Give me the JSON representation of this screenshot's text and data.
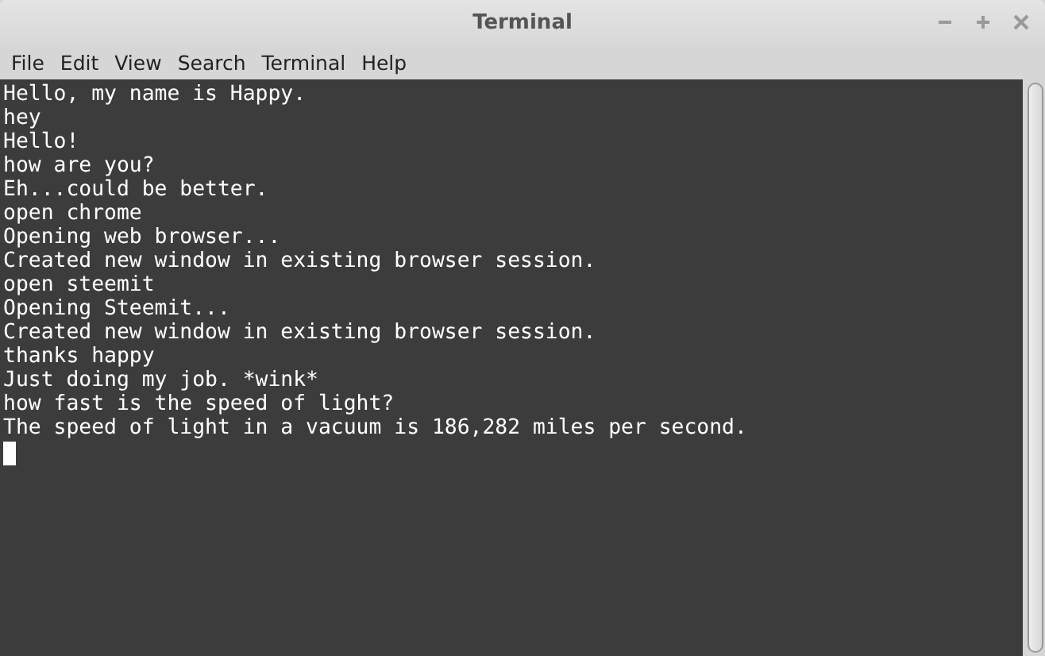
{
  "window": {
    "title": "Terminal"
  },
  "menu": [
    "File",
    "Edit",
    "View",
    "Search",
    "Terminal",
    "Help"
  ],
  "terminal": {
    "lines": [
      "Hello, my name is Happy.",
      "hey",
      "Hello!",
      "how are you?",
      "Eh...could be better.",
      "open chrome",
      "Opening web browser...",
      "Created new window in existing browser session.",
      "open steemit",
      "Opening Steemit...",
      "Created new window in existing browser session.",
      "thanks happy",
      "Just doing my job. *wink*",
      "how fast is the speed of light?",
      "The speed of light in a vacuum is 186,282 miles per second."
    ]
  }
}
